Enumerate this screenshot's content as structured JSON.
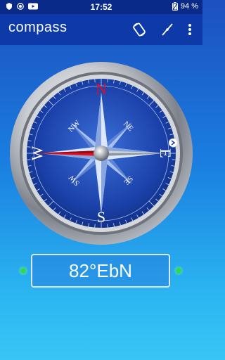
{
  "status_bar": {
    "time": "17:52",
    "battery": "94 %",
    "left_icons": [
      "shield-icon",
      "record-icon",
      "video-icon"
    ],
    "right_icons": [
      "battery-icon"
    ]
  },
  "app_bar": {
    "title": "compass",
    "actions": [
      "rotate-icon",
      "calibrate-needle-icon",
      "more-vert-icon"
    ]
  },
  "compass": {
    "cardinals": {
      "n": "N",
      "e": "E",
      "s": "S",
      "w": "W"
    },
    "intercardinals": {
      "ne": "NE",
      "se": "SE",
      "sw": "SW",
      "nw": "NW"
    },
    "heading_degrees": 82,
    "colors": {
      "north_needle": "#e01020",
      "south_needle": "#c0c8d0",
      "dial": "#1a3fa0",
      "bezel": "#b8bcc4"
    }
  },
  "readout": {
    "heading_text": "82°EbN",
    "indicator_color": "#2ddc4a"
  }
}
